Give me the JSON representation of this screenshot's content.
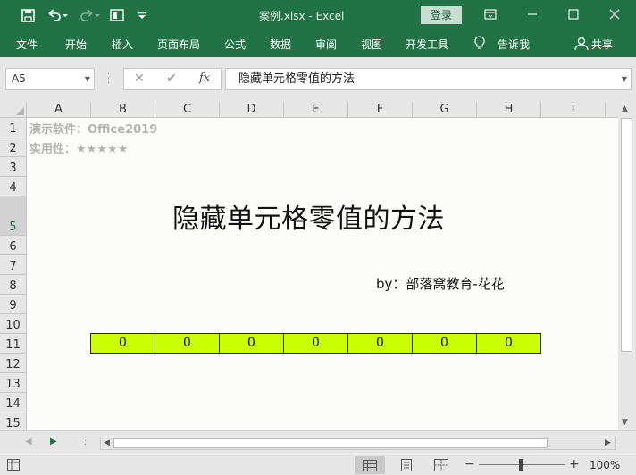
{
  "titlebar": {
    "title": "案例.xlsx  -  Excel",
    "login": "登录"
  },
  "menu": [
    {
      "name": "file",
      "label": "文件"
    },
    {
      "name": "home",
      "label": "开始"
    },
    {
      "name": "insert",
      "label": "插入"
    },
    {
      "name": "page-layout",
      "label": "页面布局"
    },
    {
      "name": "formulas",
      "label": "公式"
    },
    {
      "name": "data",
      "label": "数据"
    },
    {
      "name": "review",
      "label": "审阅"
    },
    {
      "name": "view",
      "label": "视图"
    },
    {
      "name": "developer",
      "label": "开发工具"
    },
    {
      "name": "tell-me",
      "label": "告诉我"
    },
    {
      "name": "share",
      "label": "共享"
    }
  ],
  "formula_bar": {
    "name_box": "A5",
    "fx": "fx",
    "content": "隐藏单元格零值的方法"
  },
  "columns": [
    "A",
    "B",
    "C",
    "D",
    "E",
    "F",
    "G",
    "H",
    "I"
  ],
  "rows": [
    "1",
    "2",
    "3",
    "4",
    "5",
    "6",
    "7",
    "8",
    "9",
    "10",
    "11",
    "12",
    "13",
    "14",
    "15"
  ],
  "selected_row": "5",
  "cells": {
    "A1": "演示软件：Office2019",
    "A2": "实用性：★★★★★",
    "title": "隐藏单元格零值的方法",
    "byline": "by：部落窝教育-花花",
    "row11": [
      "0",
      "0",
      "0",
      "0",
      "0",
      "0",
      "0"
    ]
  },
  "status": {
    "zoom": "100%"
  },
  "colors": {
    "brand": "#217346",
    "highlight": "#ccff00"
  }
}
